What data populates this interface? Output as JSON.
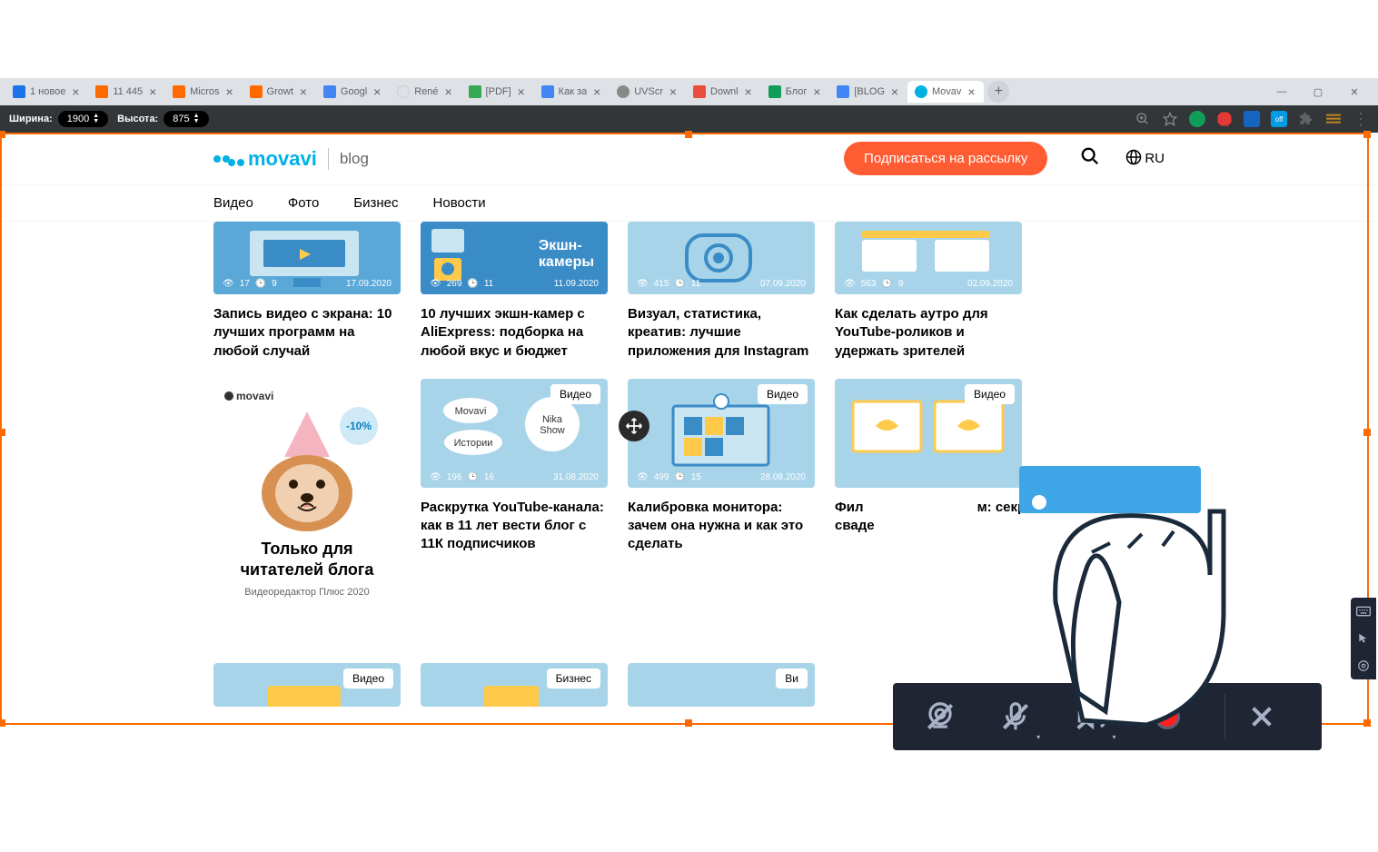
{
  "browser": {
    "tabs": [
      {
        "icon_bg": "#1a73e8",
        "text": "1 новое"
      },
      {
        "icon_bg": "#ff6a00",
        "text": "11 445"
      },
      {
        "icon_bg": "#ff6a00",
        "text": "Micros"
      },
      {
        "icon_bg": "#ff6a00",
        "text": "Growt"
      },
      {
        "icon_bg": "#4285f4",
        "text": "Googl"
      },
      {
        "icon_bg": "#fff",
        "text": "René"
      },
      {
        "icon_bg": "#34a853",
        "text": "[PDF]"
      },
      {
        "icon_bg": "#4285f4",
        "text": "Как за"
      },
      {
        "icon_bg": "#888",
        "text": "UVScr"
      },
      {
        "icon_bg": "#e94e3a",
        "text": "Downl"
      },
      {
        "icon_bg": "#0f9d58",
        "text": "Блог"
      },
      {
        "icon_bg": "#4285f4",
        "text": "[BLOG"
      },
      {
        "icon_bg": "#00b2e3",
        "text": "Movav",
        "active": true
      }
    ],
    "win": {
      "min": "—",
      "max": "▢",
      "close": "✕"
    }
  },
  "dim_bar": {
    "width_label": "Ширина:",
    "width_value": "1900",
    "height_label": "Высота:",
    "height_value": "875"
  },
  "header": {
    "logo_text": "movavi",
    "logo_sub": "blog",
    "subscribe": "Подписаться на рассылку",
    "lang": "RU"
  },
  "nav": [
    "Видео",
    "Фото",
    "Бизнес",
    "Новости"
  ],
  "cards_row1": [
    {
      "views": "17",
      "time": "9",
      "date": "17.09.2020",
      "title": "Запись видео с экрана: 10 лучших программ на любой случай",
      "bg": "#5aa8d8"
    },
    {
      "views": "269",
      "time": "11",
      "date": "11.09.2020",
      "title": "10 лучших экшн-камер с AliExpress: подборка на любой вкус и бюджет",
      "bg": "#5aa8d8",
      "overlay": "Экшн-\nкамеры"
    },
    {
      "views": "415",
      "time": "11",
      "date": "07.09.2020",
      "title": "Визуал, статистика, креатив: лучшие приложения для Instagram",
      "bg": "#8bc7e8"
    },
    {
      "views": "563",
      "time": "9",
      "date": "02.09.2020",
      "title": "Как сделать аутро для YouTube-роликов и удержать зрителей",
      "bg": "#8bc7e8"
    }
  ],
  "promo": {
    "logo": "movavi",
    "discount": "-10%",
    "title": "Только для читателей блога",
    "sub": "Видеоредактор Плюс 2020"
  },
  "cards_row2": [
    {
      "badge": "Видео",
      "views": "196",
      "time": "16",
      "date": "31.08.2020",
      "title": "Раскрутка YouTube-канала: как в 11 лет вести блог с 11К подписчиков",
      "bg": "#8bc7e8",
      "bubbles": [
        "Movavi",
        "Истории",
        "Nika Show"
      ]
    },
    {
      "badge": "Видео",
      "views": "499",
      "time": "15",
      "date": "28.08.2020",
      "title": "Калибровка монитора: зачем она нужна и как это сделать",
      "bg": "#8bc7e8"
    },
    {
      "badge": "Видео",
      "views": "",
      "time": "",
      "date": "",
      "title": "Фил                              м: секр                              \nсваде",
      "bg": "#8bc7e8"
    }
  ],
  "cards_row3": [
    {
      "badge": "Видео",
      "bg": "#8bc7e8"
    },
    {
      "badge": "Бизнес",
      "bg": "#8bc7e8"
    },
    {
      "badge": "Ви",
      "bg": "#8bc7e8"
    }
  ]
}
